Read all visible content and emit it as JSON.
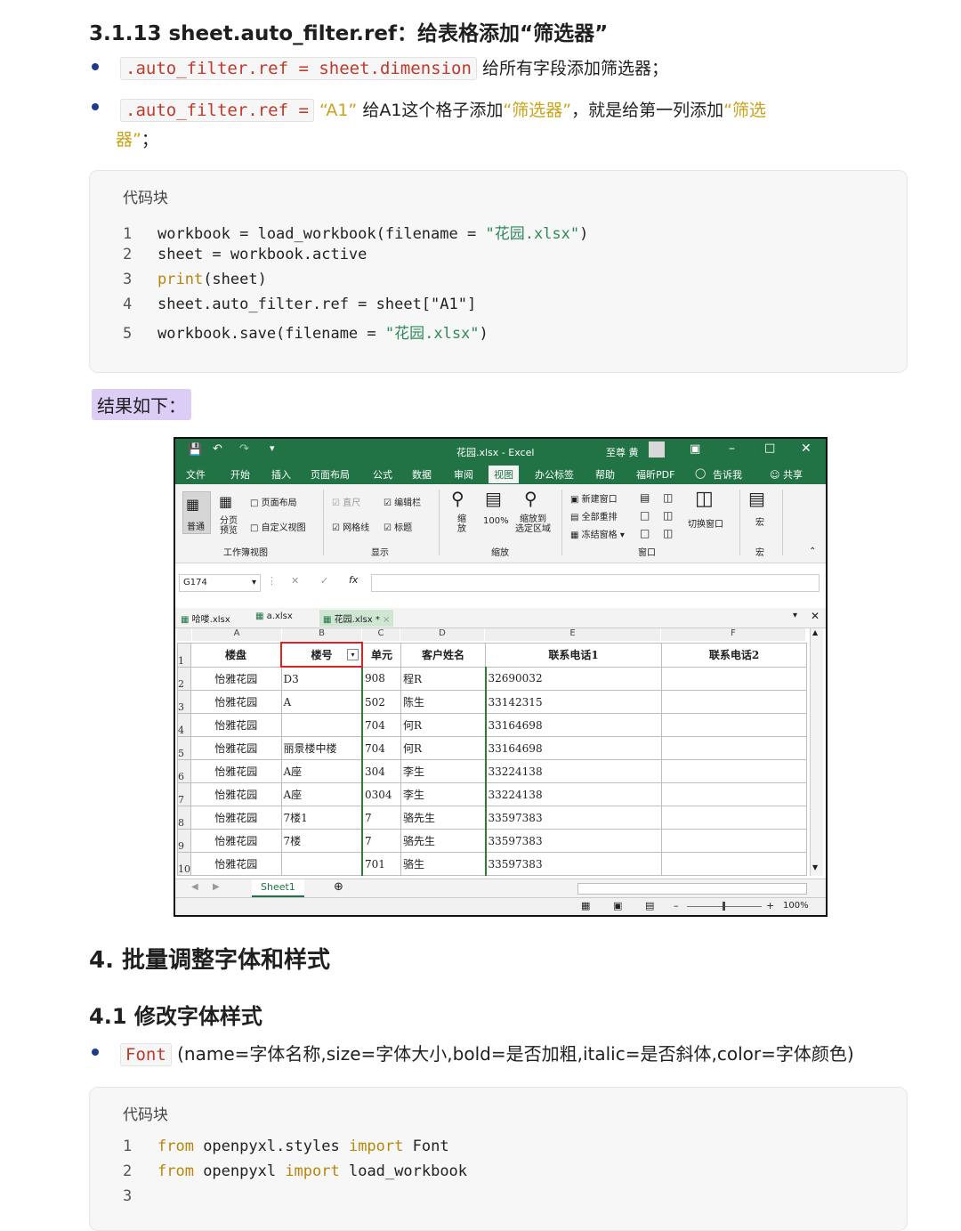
{
  "section_313": {
    "title": "3.1.13 sheet.auto_filter.ref：给表格添加“筛选器”",
    "bullet1": {
      "code": ".auto_filter.ref = sheet.dimension",
      "text": "给所有字段添加筛选器；"
    },
    "bullet2": {
      "code": ".auto_filter.ref =",
      "q1": "“A1”",
      "mid": "给A1这个格子添加",
      "q2": "“筛选器”",
      "mid2": "，就是给第一列添加",
      "q3": "“筛选",
      "q3b": "器”",
      "end": "；"
    }
  },
  "codeblock1": {
    "title": "代码块",
    "lines": [
      {
        "n": "1",
        "pre": "workbook = load_workbook(filename = ",
        "str": "\"花园.xlsx\"",
        "post": ")"
      },
      {
        "n": "2",
        "pre": "sheet = workbook.active",
        "str": "",
        "post": ""
      },
      {
        "n": "3",
        "kw": "print",
        "pre": "(sheet)",
        "str": "",
        "post": ""
      },
      {
        "n": "4",
        "pre": "sheet.auto_filter.ref = sheet[\"A1\"]",
        "str": "",
        "post": ""
      },
      {
        "n": "5",
        "pre": "workbook.save(filename = ",
        "str": "\"花园.xlsx\"",
        "post": ")"
      }
    ]
  },
  "result_label": "结果如下：",
  "excel": {
    "file_title": "花园.xlsx - Excel",
    "user": "至尊 黄",
    "tabs": [
      "文件",
      "开始",
      "插入",
      "页面布局",
      "公式",
      "数据",
      "审阅",
      "视图",
      "办公标签",
      "帮助",
      "福昕PDF",
      "告诉我",
      "共享"
    ],
    "ribbon": {
      "normal": "普通",
      "page_break": "分页\n预览",
      "page_layout": "页面布局",
      "custom_view": "自定义视图",
      "group_workbook_views": "工作簿视图",
      "ruler": "直尺",
      "formula_bar": "编辑栏",
      "gridlines": "网格线",
      "headings": "标题",
      "group_show": "显示",
      "zoom": "缩\n放",
      "zoom100": "100%",
      "zoom_selection": "缩放到\n选定区域",
      "group_zoom": "缩放",
      "new_window": "新建窗口",
      "arrange_all": "全部重排",
      "freeze_panes": "冻结窗格",
      "switch_windows": "切换窗口",
      "group_window": "窗口",
      "macros": "宏",
      "group_macros": "宏"
    },
    "name_box": "G174",
    "file_tabs": [
      "哈喽.xlsx",
      "a.xlsx",
      "花园.xlsx *"
    ],
    "col_letters": [
      "A",
      "B",
      "C",
      "D",
      "E",
      "F"
    ],
    "headers": [
      "楼盘",
      "楼号",
      "单元",
      "客户姓名",
      "联系电话1",
      "联系电话2"
    ],
    "rows": [
      [
        "1",
        "",
        "",
        "",
        "",
        "",
        ""
      ],
      [
        "2",
        "怡雅花园",
        "D3",
        "908",
        "程R",
        "32690032",
        ""
      ],
      [
        "3",
        "怡雅花园",
        "A",
        "502",
        "陈生",
        "33142315",
        ""
      ],
      [
        "4",
        "怡雅花园",
        "",
        "704",
        "何R",
        "33164698",
        ""
      ],
      [
        "5",
        "怡雅花园",
        "丽景楼中楼",
        "704",
        "何R",
        "33164698",
        ""
      ],
      [
        "6",
        "怡雅花园",
        "A座",
        "304",
        "李生",
        "33224138",
        ""
      ],
      [
        "7",
        "怡雅花园",
        "A座",
        "0304",
        "李生",
        "33224138",
        ""
      ],
      [
        "8",
        "怡雅花园",
        "7楼1",
        "7",
        "骆先生",
        "33597383",
        ""
      ],
      [
        "9",
        "怡雅花园",
        "7楼",
        "7",
        "骆先生",
        "33597383",
        ""
      ],
      [
        "10",
        "怡雅花园",
        "",
        "701",
        "骆生",
        "33597383",
        ""
      ]
    ],
    "sheet_tab": "Sheet1",
    "zoom_level": "100%"
  },
  "section_4": {
    "title": "4. 批量调整字体和样式"
  },
  "section_41": {
    "title": "4.1 修改字体样式",
    "bullet_code": "Font",
    "bullet_text": "(name=字体名称,size=字体大小,bold=是否加粗,italic=是否斜体,color=字体颜色)"
  },
  "codeblock2": {
    "title": "代码块",
    "lines": [
      {
        "n": "1",
        "kw1": "from",
        "a": " openpyxl.styles ",
        "kw2": "import",
        "b": " Font"
      },
      {
        "n": "2",
        "kw1": "from",
        "a": " openpyxl ",
        "kw2": "import",
        "b": " load_workbook"
      },
      {
        "n": "3",
        "kw1": "",
        "a": "",
        "kw2": "",
        "b": ""
      }
    ]
  }
}
